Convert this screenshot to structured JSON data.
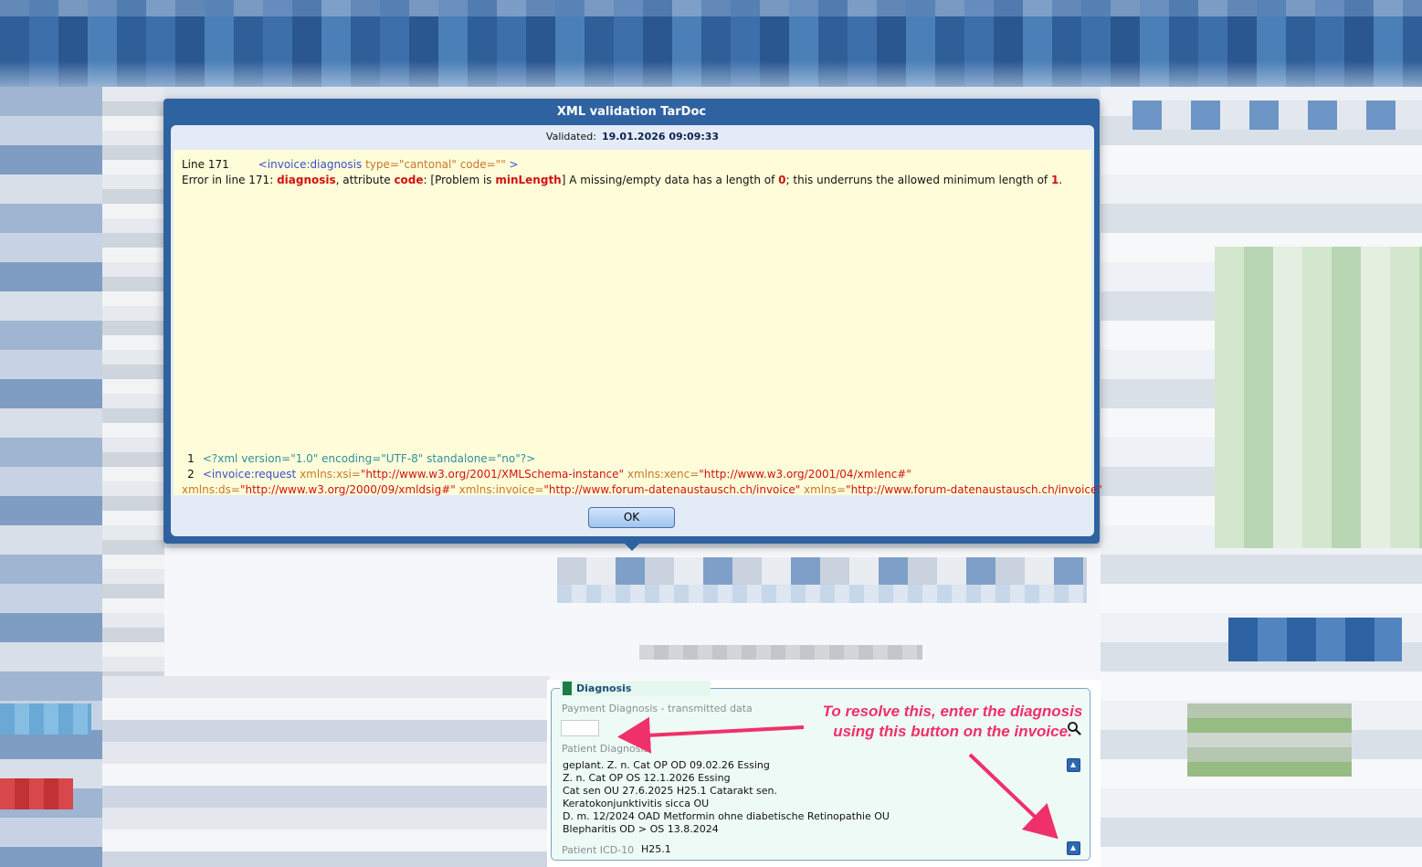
{
  "dialog": {
    "title": "XML validation TarDoc",
    "validated_label": "Validated:",
    "validated_datetime": "19.01.2026 09:09:33",
    "error": {
      "line_label": "Line 171",
      "line_tag": "<invoice:diagnosis",
      "line_attrs": "type=\"cantonal\" code=\"\"",
      "line_end": " >",
      "msg_prefix": "Error in line 171: ",
      "msg_element": "diagnosis",
      "msg_mid1": ", attribute ",
      "msg_attribute": "code",
      "msg_mid2": ": [Problem is ",
      "msg_problem": "minLength",
      "msg_mid3": "] A missing/empty data has a length of ",
      "msg_length": "0",
      "msg_mid4": "; this underruns the allowed minimum length of ",
      "msg_min": "1",
      "msg_end": "."
    },
    "xml": {
      "line1_num": "1",
      "line1_text": "<?xml version=\"1.0\" encoding=\"UTF-8\" standalone=\"no\"?>",
      "line2_num": "2",
      "line2_tag": "<invoice:request",
      "line2_a1": " xmlns:xsi=",
      "line2_v1": "\"http://www.w3.org/2001/XMLSchema-instance\"",
      "line2_a2": " xmlns:xenc=",
      "line2_v2": "\"http://www.w3.org/2001/04/xmlenc#\"",
      "line3_a1": "xmlns:ds=",
      "line3_v1": "\"http://www.w3.org/2000/09/xmldsig#\"",
      "line3_a2": " xmlns:invoice=",
      "line3_v2": "\"http://www.forum-datenaustausch.ch/invoice\"",
      "line3_a3": " xmlns=",
      "line3_v3": "\"http://www.forum-datenaustausch.ch/invoice\""
    },
    "ok_label": "OK"
  },
  "diagnosis": {
    "tab_label": "Diagnosis",
    "payment_label": "Payment Diagnosis - transmitted data",
    "payment_value": "",
    "patient_label": "Patient Diagnosis",
    "patient_lines": [
      "geplant. Z. n. Cat OP OD 09.02.26 Essing",
      "Z. n. Cat OP OS 12.1.2026 Essing",
      "Cat sen OU 27.6.2025 H25.1 Catarakt sen.",
      "Keratokonjunktivitis sicca OU",
      "D. m. 12/2024 OAD Metformin ohne diabetische Retinopathie OU",
      "Blepharitis OD > OS 13.8.2024"
    ],
    "icd_label": "Patient ICD-10",
    "icd_value": "H25.1"
  },
  "annotation": {
    "line1": "To resolve this, enter the diagnosis",
    "line2": "using this button on the invoice."
  },
  "colors": {
    "dialog_blue": "#2f62a0",
    "error_red": "#d01212",
    "annotation_pink": "#f0306a",
    "panel_yellow": "#fffdd9"
  }
}
